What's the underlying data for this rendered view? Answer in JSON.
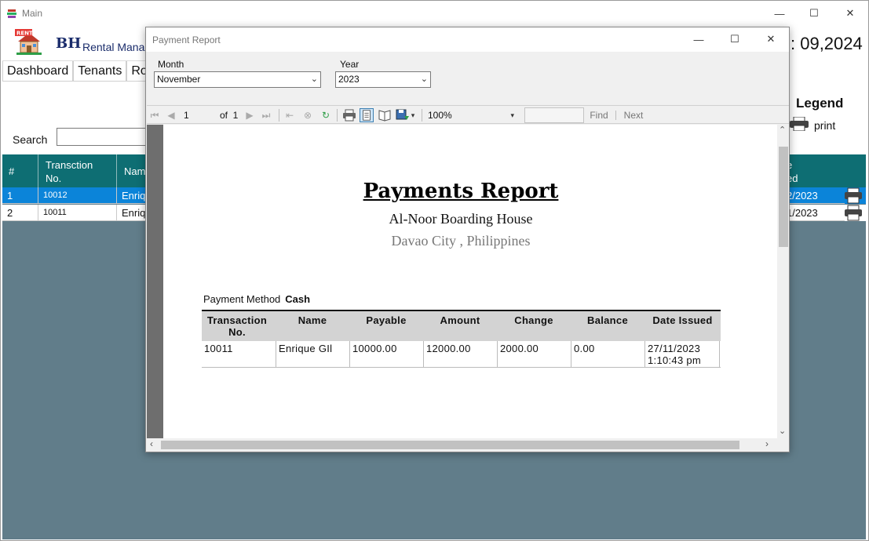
{
  "main_window": {
    "title": "Main",
    "brand_bh": "BH",
    "brand_sub": "Rental Manag",
    "date_partial": ": 09,2024",
    "menu": [
      "Dashboard",
      "Tenants",
      "Ro"
    ],
    "search_label": "Search",
    "search_value": "",
    "legend_title": "Legend",
    "legend_print": "print",
    "grid": {
      "headers": [
        "#",
        "Transction No.",
        "Nam",
        "e ed"
      ],
      "header_hash": "#",
      "header_trans_1": "Transction",
      "header_trans_2": "No.",
      "header_name": "Nam",
      "header_date_1": "e",
      "header_date_2": "ed",
      "rows": [
        {
          "num": "1",
          "trans": "10012",
          "name": "Enriq",
          "date": "2/2023"
        },
        {
          "num": "2",
          "trans": "10011",
          "name": "Enriq",
          "date": "1/2023"
        }
      ]
    },
    "colors": {
      "grid_header": "#0e6e73",
      "selected_row": "#0b84d9",
      "grid_bg": "#617d8a"
    }
  },
  "dialog": {
    "title": "Payment Report",
    "month_label": "Month",
    "month_value": "November",
    "year_label": "Year",
    "year_value": "2023",
    "toolbar": {
      "page_current": "1",
      "page_of": "of",
      "page_total": "1",
      "zoom": "100%",
      "find_value": "",
      "find_label": "Find",
      "next_label": "Next"
    },
    "report": {
      "title": "Payments Report",
      "name": "Al-Noor Boarding House",
      "location": "Davao City , Philippines",
      "payment_method_label": "Payment Method",
      "payment_method_value": "Cash",
      "columns": [
        "Transaction No.",
        "Name",
        "Payable",
        "Amount",
        "Change",
        "Balance",
        "Date Issued"
      ],
      "col_trans_1": "Transaction",
      "col_trans_2": "No.",
      "rows": [
        {
          "trans": "10011",
          "name": "Enrique GIl",
          "payable": "10000.00",
          "amount": "12000.00",
          "change": "2000.00",
          "balance": "0.00",
          "date_1": "27/11/2023",
          "date_2": "1:10:43 pm"
        }
      ]
    }
  }
}
